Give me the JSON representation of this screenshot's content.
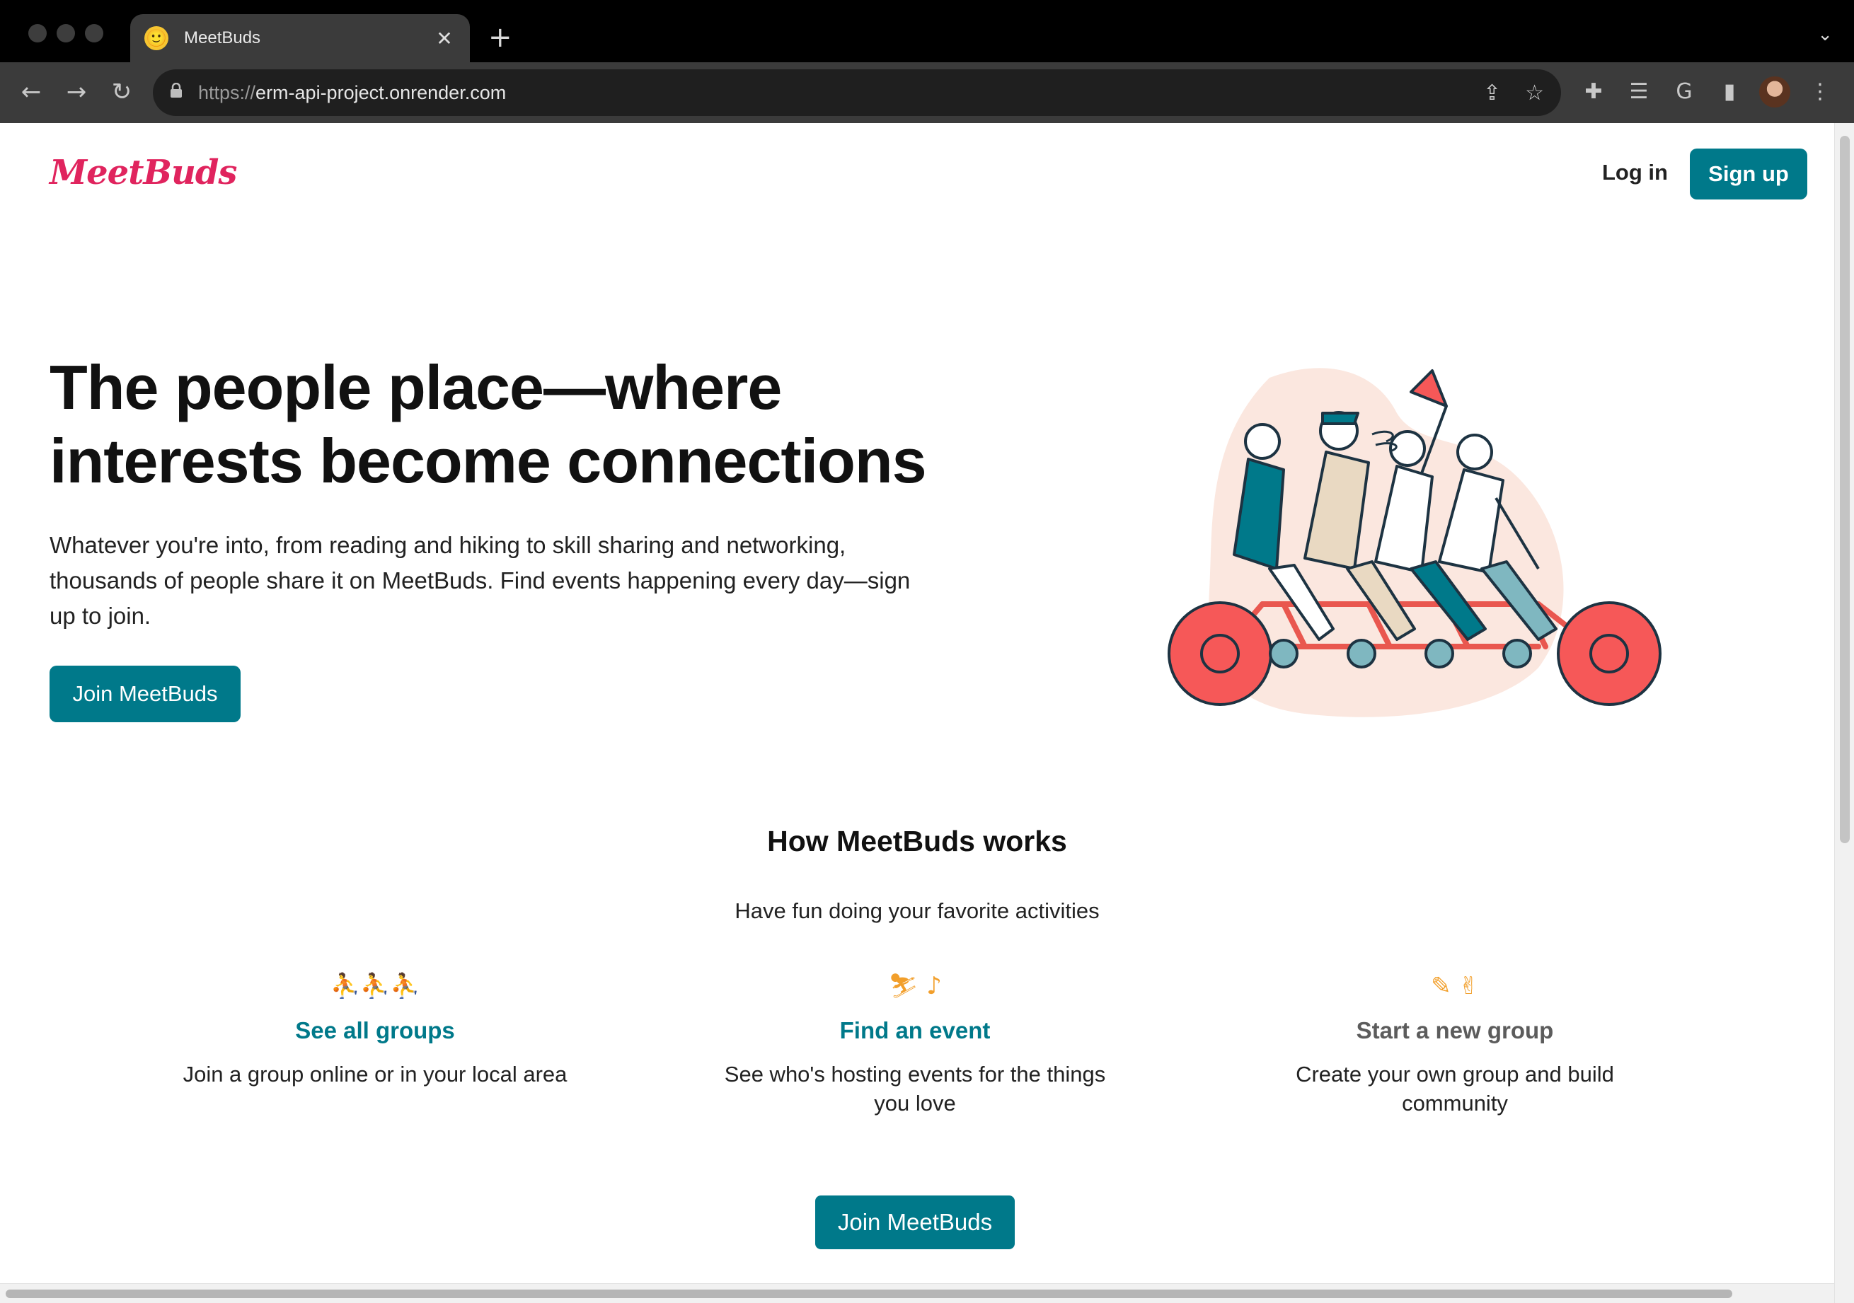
{
  "browser": {
    "tab_title": "MeetBuds",
    "tab_favicon": "🙂",
    "tab_close": "✕",
    "new_tab": "+",
    "tab_menu": "⌄",
    "back": "←",
    "forward": "→",
    "reload": "↻",
    "url_scheme": "https://",
    "url_host": "erm-api-project.onrender.com",
    "share": "⇪",
    "bookmark": "☆",
    "extensions": "✚",
    "reading_list": "☰",
    "google": "G",
    "side_panel": "▮",
    "menu": "⋮"
  },
  "header": {
    "logo": "MeetBuds",
    "login_label": "Log in",
    "signup_label": "Sign up"
  },
  "hero": {
    "title": "The people place—where interests become connections",
    "subtitle": "Whatever you're into, from reading and hiking to skill sharing and networking, thousands of people share it on MeetBuds. Find events happening every day—sign up to join.",
    "cta_label": "Join MeetBuds"
  },
  "how": {
    "title": "How MeetBuds works",
    "subtitle": "Have fun doing your favorite activities",
    "columns": [
      {
        "icon": "⛹⛹⛹",
        "icon_name": "people-icon",
        "link": "See all groups",
        "text": "Join a group online or in your local area"
      },
      {
        "icon": "⛷ ♪",
        "icon_name": "activity-icon",
        "link": "Find an event",
        "text": "See who's hosting events for the things you love"
      },
      {
        "icon": "✎ ✌",
        "icon_name": "create-icon",
        "link": "Start a new group",
        "text": "Create your own group and build community"
      }
    ],
    "cta_label": "Join MeetBuds"
  },
  "colors": {
    "brand_teal": "#00798a",
    "logo_pink": "#e0245e",
    "icon_orange": "#f29f2b",
    "wheel_red": "#f65858"
  }
}
